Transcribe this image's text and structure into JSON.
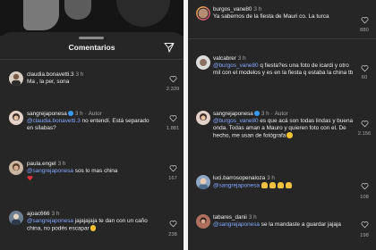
{
  "left": {
    "header": {
      "title": "Comentarios",
      "send_icon": "send-icon"
    },
    "comments": [
      {
        "user": "claudia.bonavetti.3",
        "time": "3 h",
        "parts": [
          {
            "t": "Ma , la  per, sona"
          }
        ],
        "likes": "2.339"
      },
      {
        "user": "sangrejaponesa",
        "time": "3 h",
        "author": "Autor",
        "mention": "@claudia.bonavetti.3",
        "text": " no entendí. Está separado en sílabas?",
        "likes": "1.881"
      },
      {
        "user": "paula.engel",
        "time": "3 h",
        "mention": "@sangrejaponesa",
        "text": " sos lo mas china",
        "likes": "167"
      },
      {
        "user": "ajoac666",
        "time": "3 h",
        "mention": "@sangrejaponesa",
        "text": " jajajajaja te dan con un caño china, no podés escapar",
        "likes": "238"
      }
    ]
  },
  "right": {
    "comments": [
      {
        "user": "burgos_vane80",
        "time": "3 h",
        "text": "Ya sabemos de la fiesta de Mauri co. La turca",
        "likes": "880"
      },
      {
        "user": "valcabrer",
        "time": "3 h",
        "mention": "@burgos_vane80",
        "text": " q fiesta?es una foto de icardi y otro mil con el modelos y es en la fiesta q estaba la china tb",
        "likes": "60"
      },
      {
        "user": "sangrejaponesa",
        "time": "3 h",
        "author": "Autor",
        "mention": "@burgos_vane80",
        "text": " es que acá son todas lindas y buena onda. Todas aman a Mauro y quieren foto con el. De hecho, me usan de fotógrafa",
        "likes": "2.156"
      },
      {
        "user": "luci.barrosopenaloza",
        "time": "3 h",
        "mention": "@sangrejaponesa",
        "text": "",
        "likes": "108"
      },
      {
        "user": "tabares_danii",
        "time": "3 h",
        "mention": "@sangrejaponesa",
        "text": " se la mandaste a guardar jajaja",
        "likes": "198"
      }
    ]
  },
  "colors": {
    "bg": "#262626",
    "mention": "#82a8ff",
    "verified": "#3897f0",
    "muted": "#a8a8a8"
  }
}
